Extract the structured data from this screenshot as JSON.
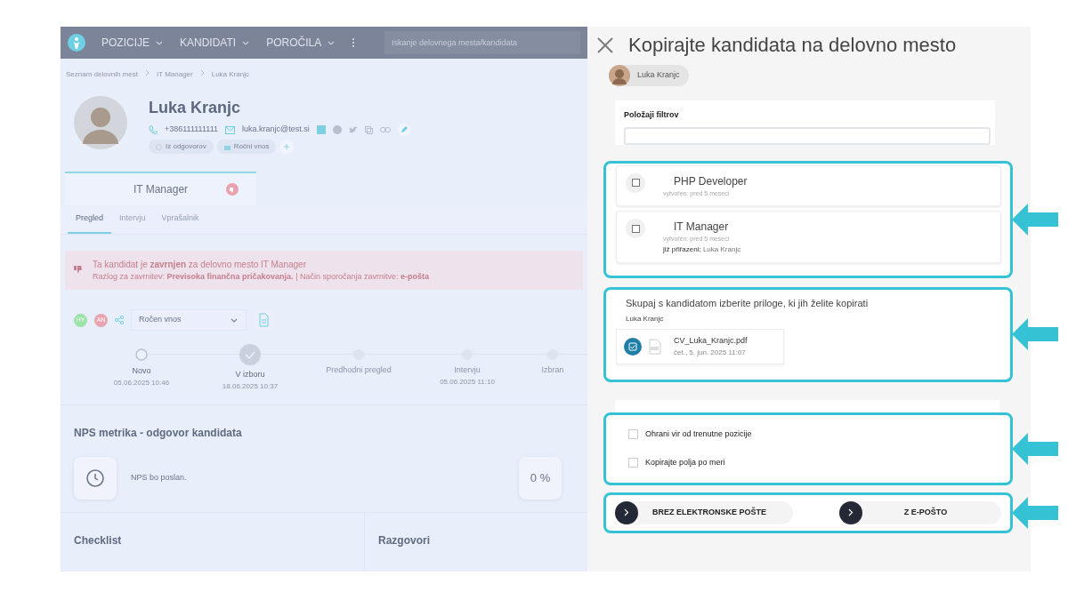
{
  "navbar": {
    "menu": [
      {
        "label": "POZICIJE"
      },
      {
        "label": "KANDIDATI"
      },
      {
        "label": "POROČILA"
      }
    ],
    "search": {
      "placeholder": "Iskanje delovnega mesta/kandidata"
    }
  },
  "breadcrumb": [
    "Seznam delovnih mest",
    "IT Manager",
    "Luka Kranjc"
  ],
  "candidate": {
    "name": "Luka Kranjc",
    "phone": "+386111111111",
    "email": "luka.kranjc@test.si",
    "tags": [
      "Iz odgovorov",
      "Ročni vnos"
    ]
  },
  "job_tab": {
    "title": "IT Manager"
  },
  "subtabs": [
    {
      "label": "Pregled",
      "selected": true
    },
    {
      "label": "Intervju",
      "selected": false
    },
    {
      "label": "Vprašalnik",
      "selected": false
    }
  ],
  "alert": {
    "line_1": "Ta kandidat je **zavrnjen** za delovno mesto IT Manager",
    "line_2": "Razlog za zavrnitev: **Previsoka finančna pričakovanja.** | Način sporočanja zavrnitve: **e-pošta**"
  },
  "users": [
    {
      "initials": "HY",
      "color": "#9be3a6"
    },
    {
      "initials": "AN",
      "color": "#e8a3b0"
    }
  ],
  "source_select": {
    "value": "Ročen vnos"
  },
  "stages": [
    {
      "label": "Novo",
      "date": "05.06.2025 10:46",
      "kind": "passed"
    },
    {
      "label": "V izboru",
      "date": "18.06.2025 10:37",
      "kind": "current"
    },
    {
      "label": "Predhodni pregled",
      "kind": "pending"
    },
    {
      "label": "Intervju",
      "date": "05.06.2025 11:10",
      "kind": "pending"
    },
    {
      "label": "Izbran",
      "kind": "pending"
    }
  ],
  "nps": {
    "title": "NPS metrika - odgovor kandidata",
    "status": "NPS bo poslan.",
    "percent": "0 %"
  },
  "sections": [
    "Checklist",
    "Razgovori"
  ],
  "dialog": {
    "title": "Kopirajte kandidata na delovno mesto",
    "candidate_chip": "Luka Kranjc",
    "filter": {
      "label": "Položaji filtrov"
    },
    "jobs": [
      {
        "title": "PHP Developer",
        "created": "vytvořen: pred 5 meseci",
        "checked": false
      },
      {
        "title": "IT Manager",
        "created": "vytvořen: pred 5 meseci",
        "assigned_label": "již přiřazeni:",
        "assigned_name": "Luka Kranjc",
        "checked": false
      }
    ],
    "attachments": {
      "title": "Skupaj s kandidatom izberite priloge, ki jih želite kopirati",
      "candidate": "Luka Kranjc",
      "files": [
        {
          "name": "CV_Luka_Kranjc.pdf",
          "date": "čet., 5. jun. 2025 11:07",
          "checked": true
        }
      ]
    },
    "options": [
      {
        "label": "Ohrani vir od trenutne pozicije",
        "checked": false
      },
      {
        "label": "Kopirajte polja po meri",
        "checked": false
      }
    ],
    "buttons": [
      {
        "label": "BREZ ELEKTRONSKE POŠTE"
      },
      {
        "label": "Z E-POŠTO"
      }
    ]
  }
}
